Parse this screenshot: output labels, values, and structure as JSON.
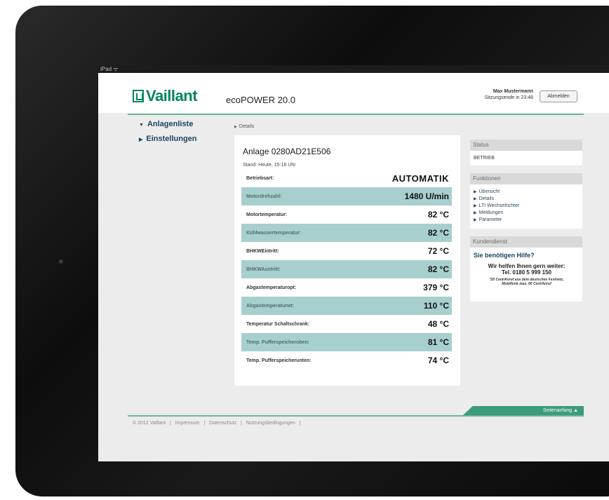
{
  "statusbar": {
    "carrier": "iPad ᯤ",
    "battery": "⚙ ▬"
  },
  "header": {
    "brand": "Vaillant",
    "product": "ecoPOWER 20.0",
    "user_name": "Max Mustermann",
    "session": "Sitzungsende in 23:48",
    "logout_label": "Abmelden"
  },
  "sidebar": {
    "items": [
      {
        "label": "Anlagenliste",
        "icon": "▼"
      },
      {
        "label": "Einstellungen",
        "icon": "▶"
      }
    ]
  },
  "breadcrumb": {
    "icon": "▶",
    "label": "Details"
  },
  "detail": {
    "title": "Anlage 0280AD21E506",
    "stand": "Stand: Heute, 15:18 Uhr",
    "rows": [
      {
        "label": "Betriebsart:",
        "value": "AUTOMATIK"
      },
      {
        "label": "Motordrehzahl:",
        "value": "1480 U/min"
      },
      {
        "label": "Motortemperatur:",
        "value": "82 °C"
      },
      {
        "label": "Kühlwassertemperatur:",
        "value": "82 °C"
      },
      {
        "label": "BHKWEintritt:",
        "value": "72 °C"
      },
      {
        "label": "BHKWAustritt:",
        "value": "82 °C"
      },
      {
        "label": "Abgastemperaturopt:",
        "value": "379 °C"
      },
      {
        "label": "Abgastemperaturwt:",
        "value": "110 °C"
      },
      {
        "label": "Temperatur Schaltschrank:",
        "value": "48 °C"
      },
      {
        "label": "Temp. Pufferspeicheroben:",
        "value": "81 °C"
      },
      {
        "label": "Temp. Pufferspeicherunten:",
        "value": "74 °C"
      }
    ]
  },
  "status_panel": {
    "title": "Status",
    "value": "BETRIEB"
  },
  "functions_panel": {
    "title": "Funktionen",
    "items": [
      "Übersicht",
      "Details",
      "LTI Wechselrichter",
      "Meldungen",
      "Parameter"
    ]
  },
  "service_panel": {
    "title": "Kundendienst",
    "question": "Sie benötigen Hilfe?",
    "answer_line1": "Wir helfen Ihnen gern weiter:",
    "answer_line2": "Tel. 0180 5 999 150",
    "fine_print_1": "*20 Cent/Anruf aus dem deutschen Festnetz,",
    "fine_print_2": "Mobilfunk max. 60 Cent/Anruf"
  },
  "back_to_top": "Seitenanfang ▲",
  "footer": {
    "links": [
      "© 2012 Vaillant",
      "|",
      "Impressum",
      "|",
      "Datenschutz",
      "|",
      "Nutzungsbedingungen",
      "|"
    ]
  },
  "colors": {
    "accent_green": "#00875a",
    "row_shade": "#a7cfce",
    "nav_blue": "#1a4460"
  }
}
